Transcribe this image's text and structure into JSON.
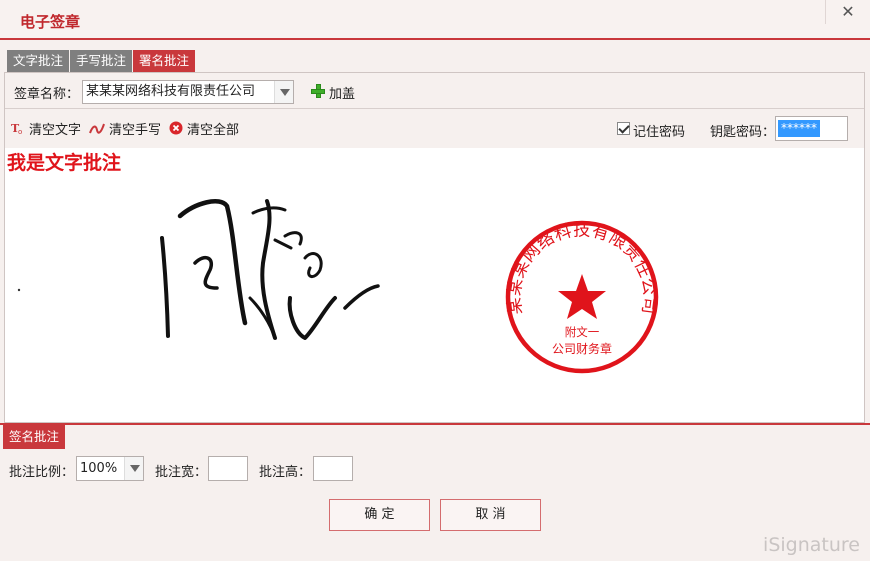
{
  "window": {
    "title": "电子签章",
    "close_glyph": "✕"
  },
  "tabs": [
    {
      "label": "文字批注",
      "active": false
    },
    {
      "label": "手写批注",
      "active": false
    },
    {
      "label": "署名批注",
      "active": true
    }
  ],
  "seal_row": {
    "name_label": "签章名称：",
    "name_value": "某某某网络科技有限责任公司",
    "add_label": "加盖"
  },
  "tools": {
    "clear_text": "清空文字",
    "clear_handwriting": "清空手写",
    "clear_all": "清空全部",
    "remember_label": "记住密码",
    "remember_checked": true,
    "key_password_label": "钥匙密码：",
    "key_password_value": "******"
  },
  "canvas": {
    "text_annotation": "我是文字批注",
    "seal": {
      "ring_text": "某某某网络科技有限责任公司",
      "line1": "附文一",
      "line2": "公司财务章",
      "color": "#e0141b"
    }
  },
  "bottom": {
    "section_tab": "签名批注",
    "scale_label": "批注比例：",
    "scale_value": "100%",
    "width_label": "批注宽：",
    "height_label": "批注高：",
    "ok_button": "确 定",
    "cancel_button": "取 消"
  },
  "brand": {
    "watermark": "iSignature"
  },
  "colors": {
    "accent": "#c9383c",
    "seal_red": "#e0141b"
  }
}
